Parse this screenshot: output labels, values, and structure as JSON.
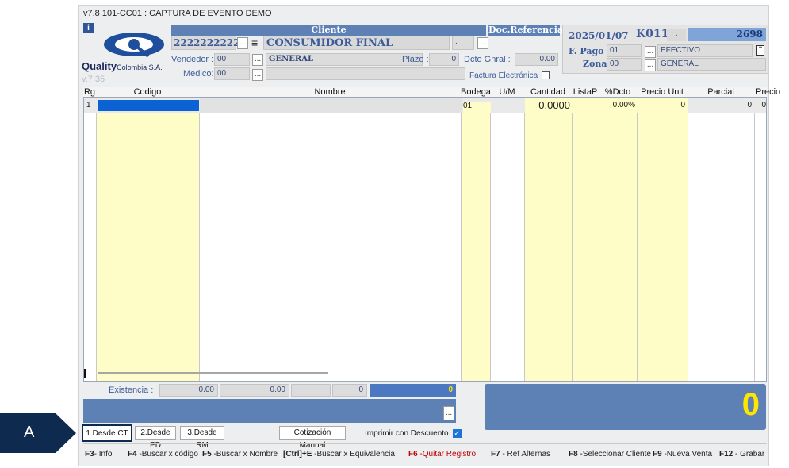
{
  "window": {
    "title": "v7.8 101-CC01 : CAPTURA DE EVENTO DEMO"
  },
  "logo": {
    "brand": "Quality",
    "sub": "Colombia S.A.",
    "version": "v.7.35"
  },
  "client": {
    "header": "Cliente",
    "id": "22222222222",
    "name": "CONSUMIDOR FINAL",
    "vendedor_label": "Vendedor :",
    "vendedor_code": "00",
    "vendedor_name": "GENERAL",
    "medico_label": "Medico:",
    "medico_code": "00",
    "plazo_label": "Plazo :",
    "plazo_value": "0",
    "dcto_label": "Dcto Gnral :",
    "dcto_value": "0.00",
    "ellipsis": "...",
    "dot": "."
  },
  "docref": {
    "header": "Doc.Referencia",
    "factura_label": "Factura Electrónica"
  },
  "info": {
    "date": "2025/01/07",
    "code": "K011",
    "dot": ".",
    "number": "2698",
    "fpago_label": "F. Pago",
    "fpago_code": "01",
    "fpago_name": "EFECTIVO",
    "zona_label": "Zona",
    "zona_code": "00",
    "zona_name": "GENERAL"
  },
  "grid": {
    "headers": [
      "Rg",
      "Codigo",
      "Nombre",
      "Bodega",
      "U/M",
      "Cantidad",
      "ListaP",
      "%Dcto",
      "Precio Unit",
      "Parcial",
      "Precio B"
    ],
    "row": {
      "rg": "1",
      "codigo": "",
      "nombre": "",
      "bodega": "01",
      "um": "",
      "cantidad": "0.0000",
      "listap": "",
      "dcto": "0.00%",
      "precio_unit": "0",
      "parcial": "0",
      "precio_b": "0"
    }
  },
  "existencia": {
    "label": "Existencia :",
    "v1": "0.00",
    "v2": "0.00",
    "v3": "0",
    "v4": "0"
  },
  "total": {
    "value": "0"
  },
  "buttons": {
    "desde_ct": "1.Desde CT",
    "desde_pd": "2.Desde PD",
    "desde_rm": "3.Desde RM",
    "cotizacion": "Cotización Manual",
    "imprimir": "Imprimir con Descuento",
    "ellipsis": "..."
  },
  "callout": {
    "label": "A"
  },
  "fkeys": [
    {
      "key": "F3",
      "text": "- Info"
    },
    {
      "key": "F4",
      "text": " -Buscar x código"
    },
    {
      "key": "F5",
      "text": " -Buscar x Nombre"
    },
    {
      "key": "[Ctrl]+E",
      "text": " -Buscar x Equivalencia"
    },
    {
      "key": "F6",
      "text": " -Quitar Registro"
    },
    {
      "key": "F7",
      "text": " - Ref Alternas"
    },
    {
      "key": "F8",
      "text": " -Seleccionar Cliente"
    },
    {
      "key": "F9",
      "text": " -Nueva Venta"
    },
    {
      "key": "F12",
      "text": " - Grabar"
    }
  ]
}
